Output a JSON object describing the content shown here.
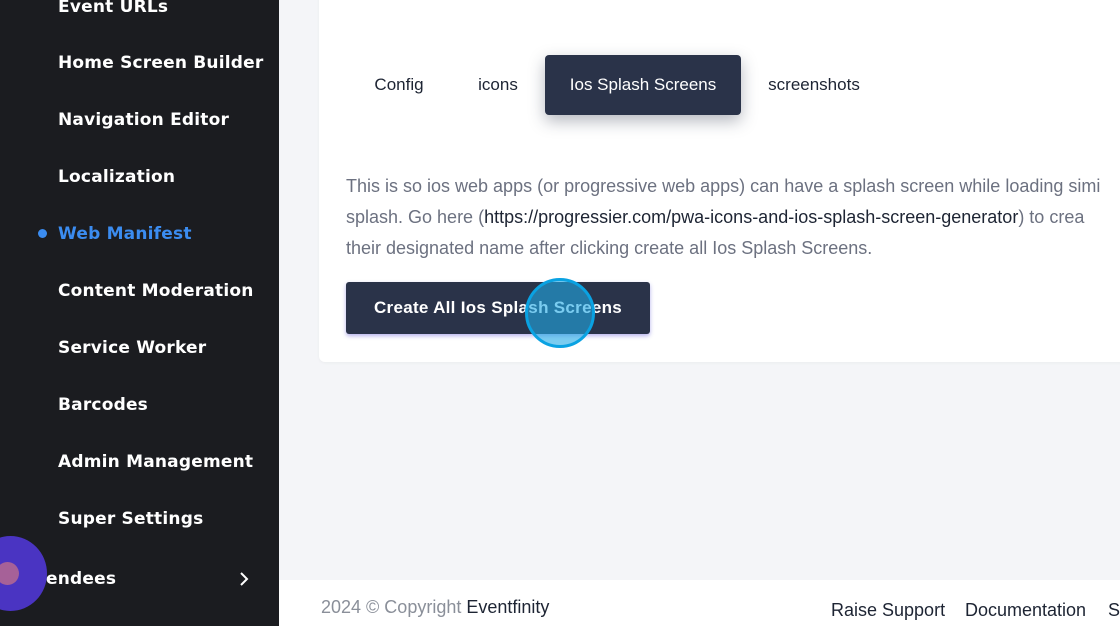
{
  "sidebar": {
    "items": [
      {
        "label": "Event URLs"
      },
      {
        "label": "Home Screen Builder"
      },
      {
        "label": "Navigation Editor"
      },
      {
        "label": "Localization"
      },
      {
        "label": "Web Manifest",
        "active": true
      },
      {
        "label": "Content Moderation"
      },
      {
        "label": "Service Worker"
      },
      {
        "label": "Barcodes"
      },
      {
        "label": "Admin Management"
      },
      {
        "label": "Super Settings"
      },
      {
        "label": "endees"
      }
    ],
    "active_color": "#3b8cf0",
    "background": "#1b1c20"
  },
  "tabs": [
    {
      "label": "Config"
    },
    {
      "label": "icons"
    },
    {
      "label": "Ios Splash Screens",
      "active": true
    },
    {
      "label": "screenshots"
    }
  ],
  "description": {
    "line1": "This is so ios web apps (or progressive web apps) can have a splash screen while loading simi",
    "line2_start": "splash. Go here (",
    "link": "https://progressier.com/pwa-icons-and-ios-splash-screen-generator",
    "line2_end": ") to crea",
    "line3": "their designated name after clicking create all Ios Splash Screens."
  },
  "actions": {
    "create_all_label": "Create All Ios Splash Screens"
  },
  "footer": {
    "copyright": "2024 © Copyright ",
    "brand": "Eventfinity",
    "links": [
      "Raise Support",
      "Documentation",
      "S"
    ]
  },
  "colors": {
    "primary_button": "#2a3349",
    "click_marker": "#22aae6"
  }
}
